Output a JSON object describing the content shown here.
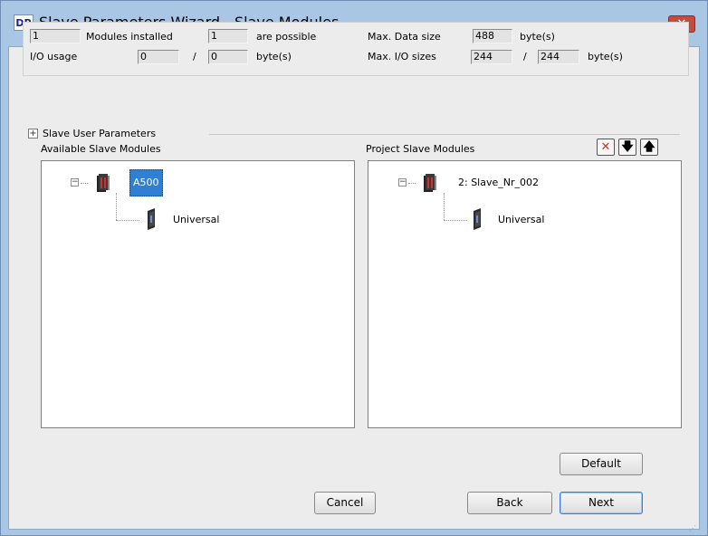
{
  "window": {
    "logo": "DP",
    "title": "Slave Parameters Wizard - Slave Modules",
    "close": "✕"
  },
  "info": {
    "modules_installed_value": "1",
    "modules_installed_label": "Modules installed",
    "possible_value": "1",
    "possible_label": "are possible",
    "io_usage_label": "I/O usage",
    "io_usage_in": "0",
    "io_usage_sep": "/",
    "io_usage_out": "0",
    "io_usage_unit": "byte(s)",
    "max_data_size_label": "Max. Data size",
    "max_data_size_value": "488",
    "max_data_size_unit": "byte(s)",
    "max_io_sizes_label": "Max. I/O sizes",
    "max_io_in": "244",
    "max_io_sep": "/",
    "max_io_out": "244",
    "max_io_unit": "byte(s)"
  },
  "slave_user_parameters": {
    "expander": "+",
    "label": "Slave User Parameters"
  },
  "available": {
    "header": "Available Slave Modules",
    "root": "A500",
    "child": "Universal"
  },
  "project": {
    "header": "Project Slave Modules",
    "root": "2: Slave_Nr_002",
    "child": "Universal",
    "delete_icon": "✕",
    "down_icon": "🡇",
    "up_icon": "🡅"
  },
  "buttons": {
    "default": "Default",
    "cancel": "Cancel",
    "back": "Back",
    "next": "Next"
  },
  "colors": {
    "title_bg": "#a9c6e4",
    "close_bg": "#c74a3a",
    "selection": "#2f7fd2"
  }
}
